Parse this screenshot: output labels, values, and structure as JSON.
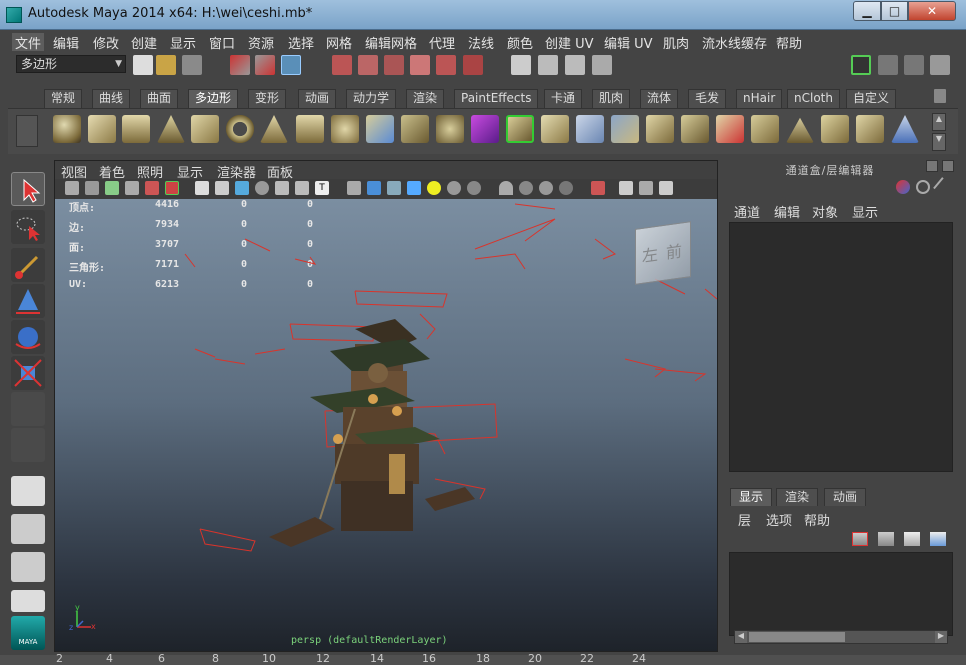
{
  "window": {
    "title": "Autodesk Maya 2014 x64: H:\\wei\\ceshi.mb*",
    "min_label": "▁",
    "max_label": "□",
    "close_label": "✕"
  },
  "menubar": {
    "items": [
      "文件",
      "编辑",
      "修改",
      "创建",
      "显示",
      "窗口",
      "资源",
      "选择",
      "网格",
      "编辑网格",
      "代理",
      "法线",
      "颜色",
      "创建 UV",
      "编辑 UV",
      "肌肉",
      "流水线缓存",
      "帮助"
    ]
  },
  "statusline": {
    "mode_value": "多边形"
  },
  "shelf": {
    "tabs": [
      "常规",
      "曲线",
      "曲面",
      "多边形",
      "变形",
      "动画",
      "动力学",
      "渲染",
      "PaintEffects",
      "卡通",
      "肌肉",
      "流体",
      "毛发",
      "nHair",
      "nCloth",
      "自定义"
    ],
    "active_tab": "多边形"
  },
  "viewport": {
    "menu": [
      "视图",
      "着色",
      "照明",
      "显示",
      "渲染器",
      "面板"
    ],
    "hud": {
      "rows": [
        {
          "label": "顶点:",
          "v1": "4416",
          "v2": "0",
          "v3": "0"
        },
        {
          "label": "边:",
          "v1": "7934",
          "v2": "0",
          "v3": "0"
        },
        {
          "label": "面:",
          "v1": "3707",
          "v2": "0",
          "v3": "0"
        },
        {
          "label": "三角形:",
          "v1": "7171",
          "v2": "0",
          "v3": "0"
        },
        {
          "label": "UV:",
          "v1": "6213",
          "v2": "0",
          "v3": "0"
        }
      ]
    },
    "viewcube": {
      "left": "左",
      "front": "前"
    },
    "camera_label": "persp (defaultRenderLayer)",
    "axis": {
      "x": "x",
      "y": "y",
      "z": "z"
    }
  },
  "channelbox": {
    "title": "通道盒/层编辑器",
    "menu": [
      "通道",
      "编辑",
      "对象",
      "显示"
    ],
    "layer_tabs": [
      "显示",
      "渲染",
      "动画"
    ],
    "layer_menu": [
      "层",
      "选项",
      "帮助"
    ]
  },
  "toolbox": {
    "label_maya": "MAYA"
  },
  "timeline": {
    "ticks": [
      "2",
      "4",
      "6",
      "8",
      "10",
      "12",
      "14",
      "16",
      "18",
      "20",
      "22",
      "24"
    ]
  },
  "colors": {
    "accent_red": "#d9342b",
    "viewport_top": "#7b8ea1",
    "viewport_bottom": "#1e232a",
    "hud_green": "#7bd27b"
  }
}
